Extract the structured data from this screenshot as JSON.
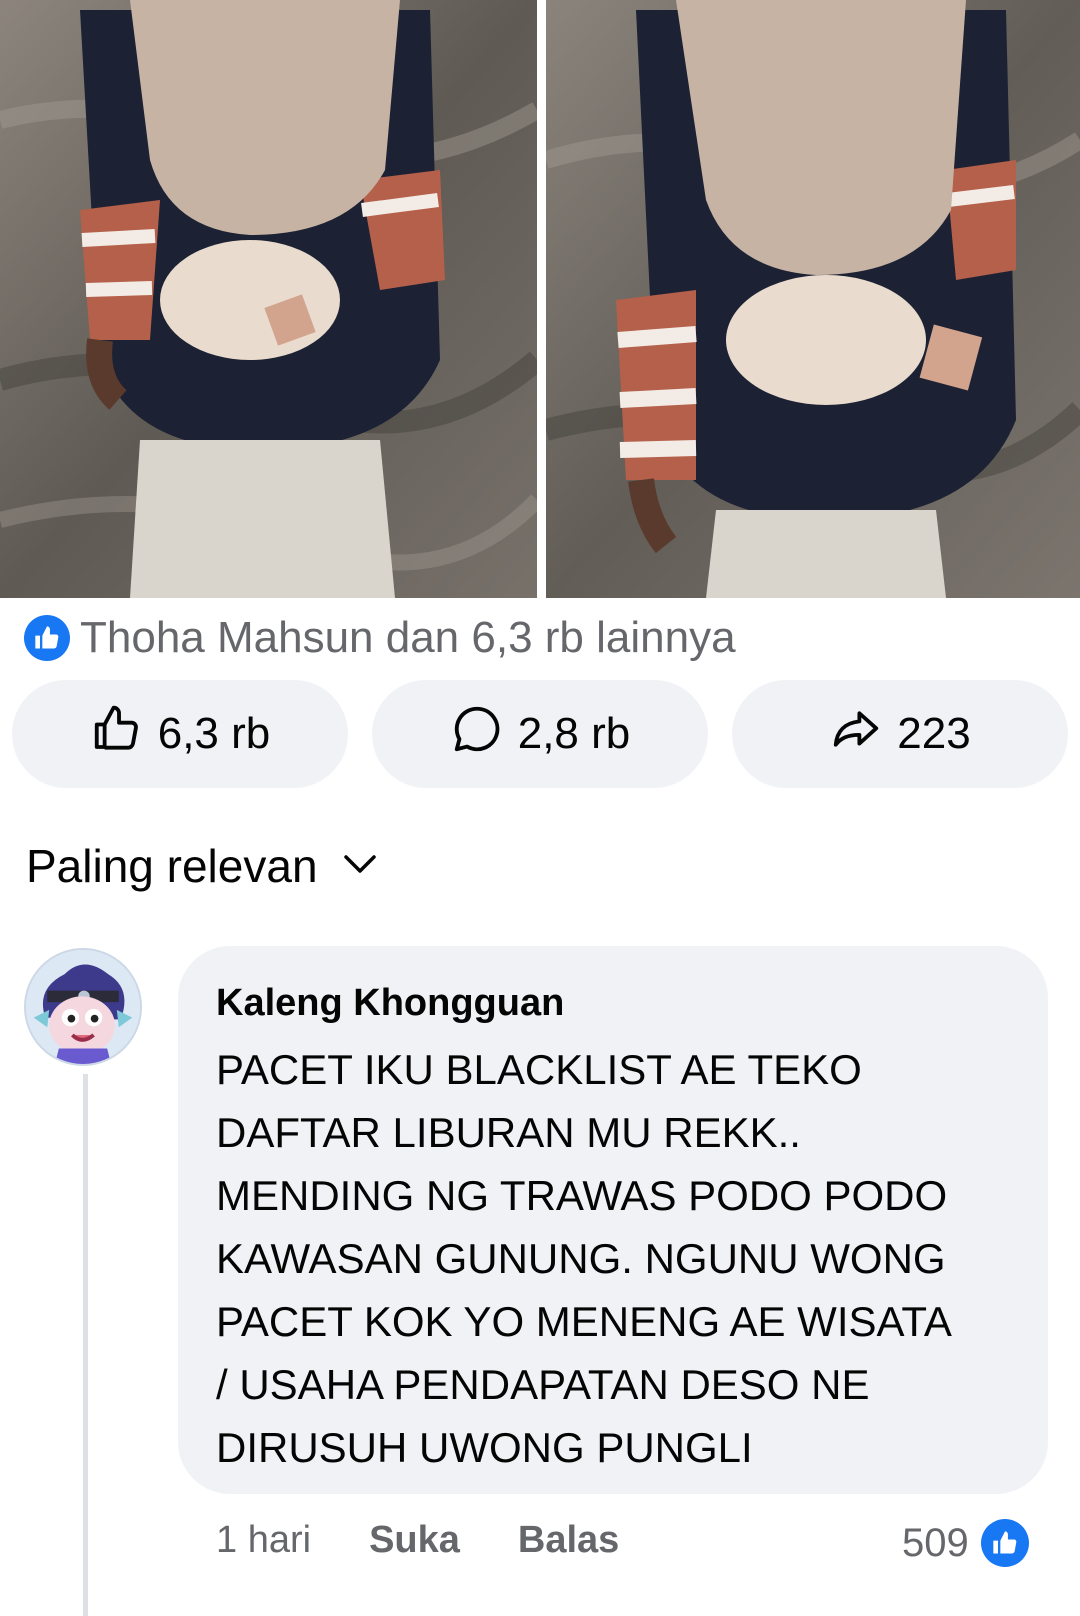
{
  "post": {
    "reactions_summary": "Thoha Mahsun dan 6,3 rb lainnya",
    "actions": {
      "like_count": "6,3 rb",
      "comment_count": "2,8 rb",
      "share_count": "223"
    }
  },
  "comments": {
    "sort_label": "Paling relevan",
    "items": [
      {
        "author": "Kaleng Khongguan",
        "text": "PACET IKU BLACKLIST AE TEKO\nDAFTAR LIBURAN MU REKK..\nMENDING NG TRAWAS PODO PODO\nKAWASAN GUNUNG. NGUNU WONG\nPACET KOK YO MENENG AE WISATA\n/ USAHA PENDAPATAN DESO NE\nDIRUSUH UWONG PUNGLI",
        "time": "1 hari",
        "like_label": "Suka",
        "reply_label": "Balas",
        "reaction_count": "509"
      }
    ]
  },
  "colors": {
    "accent": "#1877f2",
    "button_bg": "#f0f2f5",
    "secondary_text": "#65676b"
  },
  "icons": [
    "like-icon",
    "comment-icon",
    "share-icon",
    "chevron-down-icon"
  ]
}
